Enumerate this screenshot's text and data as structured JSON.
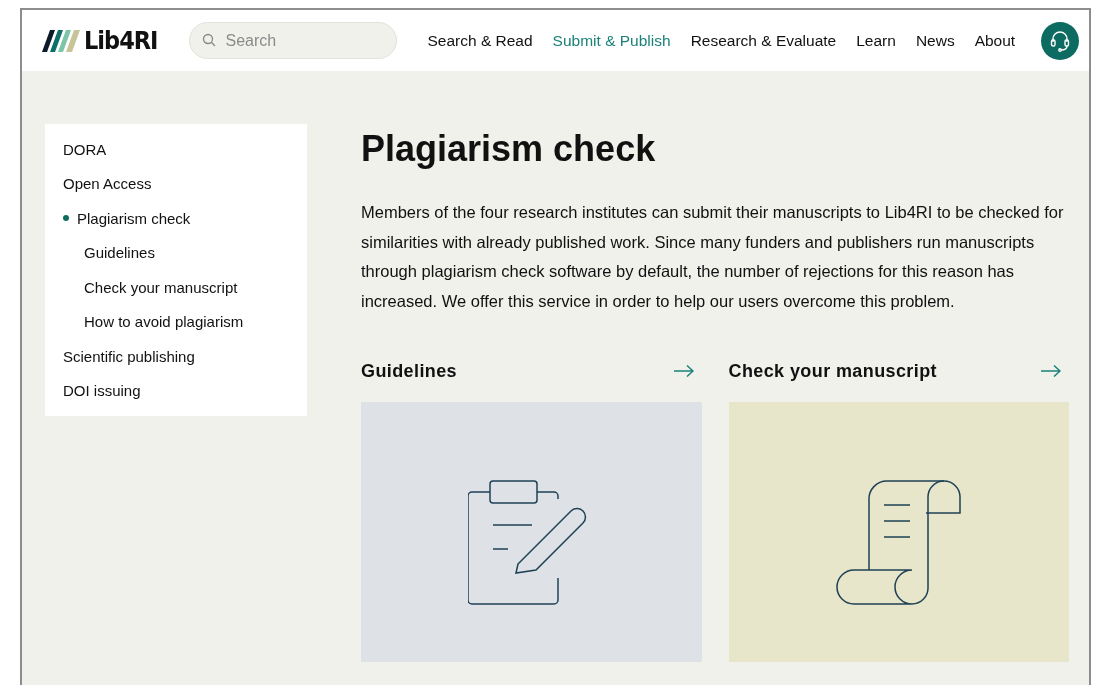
{
  "header": {
    "logo": "Lib4RI",
    "search": {
      "placeholder": "Search"
    },
    "nav": [
      {
        "label": "Search & Read",
        "selected": false
      },
      {
        "label": "Submit & Publish",
        "selected": true
      },
      {
        "label": "Research & Evaluate",
        "selected": false
      },
      {
        "label": "Learn",
        "selected": false
      },
      {
        "label": "News",
        "selected": false
      },
      {
        "label": "About",
        "selected": false
      }
    ]
  },
  "sidebar": {
    "items": [
      {
        "label": "DORA",
        "selected": false
      },
      {
        "label": "Open Access",
        "selected": false
      },
      {
        "label": "Plagiarism check",
        "selected": true,
        "children": [
          {
            "label": "Guidelines",
            "selected": false
          },
          {
            "label": "Check your manuscript",
            "selected": false
          },
          {
            "label": "How to avoid plagiarism",
            "selected": false
          }
        ]
      },
      {
        "label": "Scientific publishing",
        "selected": false
      },
      {
        "label": "DOI issuing",
        "selected": false
      }
    ]
  },
  "main": {
    "title": "Plagiarism check",
    "intro": "Members of the four research institutes can submit their manuscripts to Lib4RI to be checked for similarities with already published work. Since many funders and publishers run manuscripts through plagiarism check software by default, the number of rejections for this reason has increased. We offer this service in order to help our users overcome this problem.",
    "cards": [
      {
        "title": "Guidelines",
        "kind": "clipboard",
        "color": "#dee2e6"
      },
      {
        "title": "Check your manuscript",
        "kind": "scroll",
        "color": "#e7e5ca"
      }
    ]
  }
}
